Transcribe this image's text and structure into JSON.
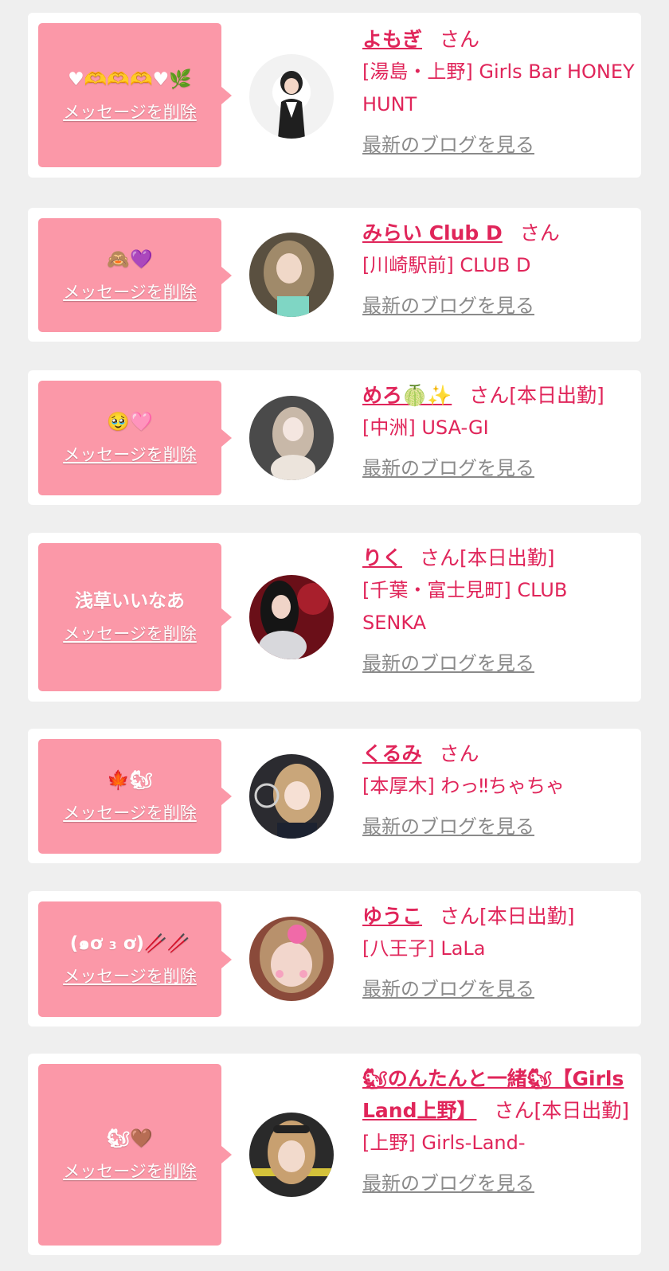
{
  "delete_label": "メッセージを削除",
  "blog_label": "最新のブログを見る",
  "colors": {
    "accent": "#e0255a",
    "bubble": "#fb98a8",
    "link_gray": "#8a8a8a",
    "background": "#efefef"
  },
  "cards": [
    {
      "message": "♥🫶🫶🫶♥🌿",
      "name": "よもぎ",
      "suffix": "さん",
      "shop": "[湯島・上野] Girls Bar HONEY HUNT"
    },
    {
      "message": "🙈💜",
      "name": "みらい Club D",
      "suffix": "さん",
      "shop": "[川崎駅前] CLUB D"
    },
    {
      "message": "🥹🩷",
      "name": "めろ🍈✨",
      "suffix": "さん[本日出勤]",
      "shop": "[中洲] USA-GI"
    },
    {
      "message": "浅草いいなあ",
      "name": "りく",
      "suffix": "さん[本日出勤]",
      "shop": "[千葉・富士見町] CLUB SENKA"
    },
    {
      "message": "🍁🐿",
      "name": "くるみ",
      "suffix": "さん",
      "shop": "[本厚木] わっ‼ちゃちゃ"
    },
    {
      "message": "(๑ơ ₃ ơ)🥢🥢",
      "name": "ゆうこ",
      "suffix": "さん[本日出勤]",
      "shop": "[八王子] LaLa"
    },
    {
      "message": "🐿🤎",
      "name": "🐿のんたんと一緒🐿【Girls Land上野】",
      "suffix": "さん[本日出勤]",
      "shop": "[上野] Girls-Land-"
    }
  ]
}
